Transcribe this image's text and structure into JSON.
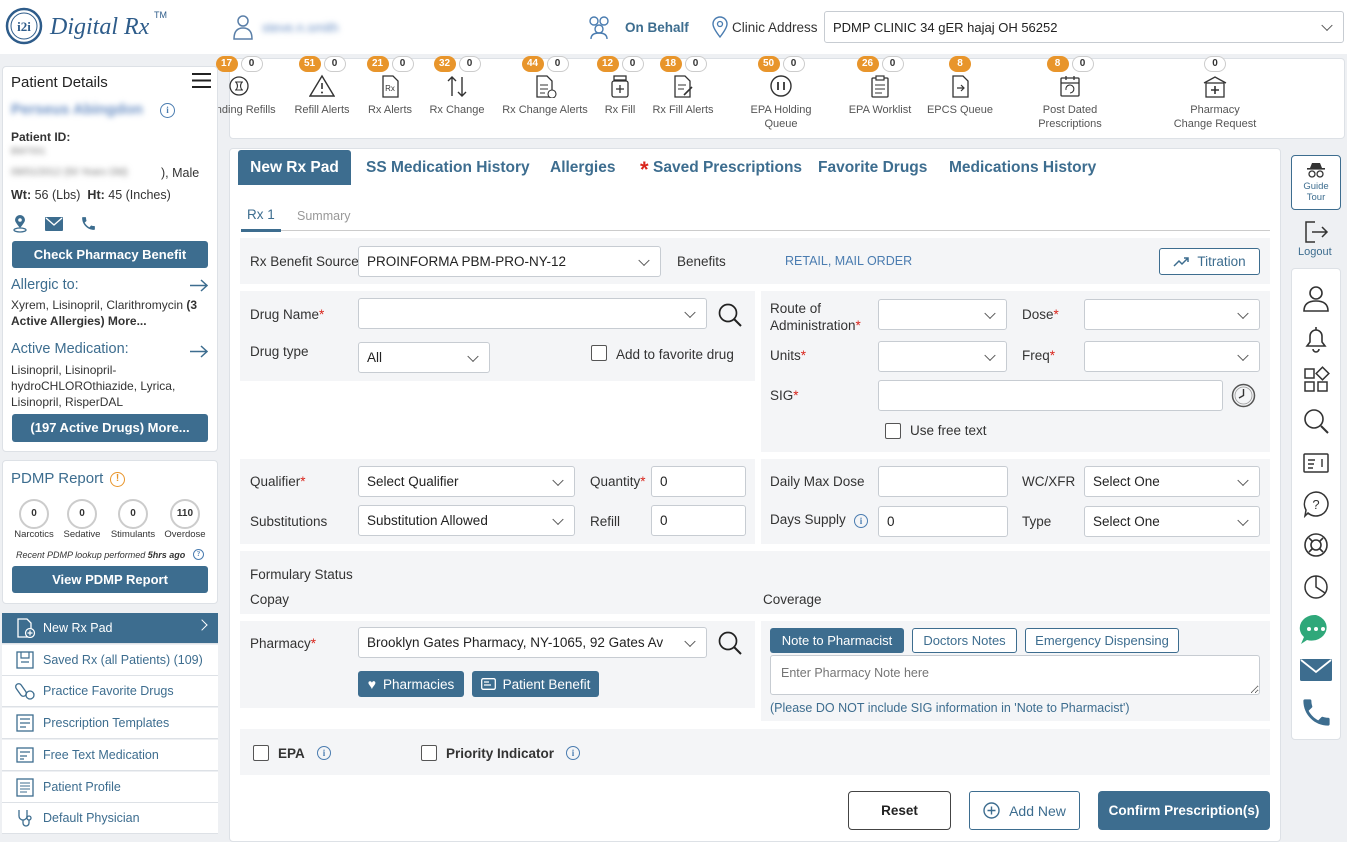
{
  "header": {
    "logo_text": "Digital Rx",
    "user_name": "steve.n.smith",
    "on_behalf": "On Behalf",
    "clinic_label": "Clinic Address",
    "clinic_value": "PDMP CLINIC 34 gER hajaj OH 56252"
  },
  "queues": [
    {
      "label": "Pending Refills",
      "count": "17",
      "extra": "0",
      "icon": "refill-pending-icon"
    },
    {
      "label": "Refill Alerts",
      "count": "51",
      "extra": "0",
      "icon": "warning-icon"
    },
    {
      "label": "Rx Alerts",
      "count": "21",
      "extra": "0",
      "icon": "rx-alert-icon"
    },
    {
      "label": "Rx Change",
      "count": "32",
      "extra": "0",
      "icon": "swap-arrows-icon"
    },
    {
      "label": "Rx Change Alerts",
      "count": "44",
      "extra": "0",
      "icon": "rx-change-alert-icon"
    },
    {
      "label": "Rx Fill",
      "count": "12",
      "extra": "0",
      "icon": "pill-bottle-icon"
    },
    {
      "label": "Rx Fill Alerts",
      "count": "18",
      "extra": "0",
      "icon": "rx-fill-alert-icon"
    },
    {
      "label": "EPA Holding Queue",
      "count": "50",
      "extra": "0",
      "icon": "pause-icon"
    },
    {
      "label": "EPA Worklist",
      "count": "26",
      "extra": "0",
      "icon": "clipboard-icon"
    },
    {
      "label": "EPCS Queue",
      "count": "8",
      "extra": "",
      "icon": "epcs-icon"
    },
    {
      "label": "Post Dated Prescriptions",
      "count": "8",
      "extra": "0",
      "icon": "calendar-refresh-icon"
    },
    {
      "label": "Pharmacy Change Request",
      "count": "",
      "extra": "0",
      "icon": "pharmacy-icon"
    }
  ],
  "patient": {
    "section_title": "Patient Details",
    "name": "Perseus Abingdon",
    "id_label": "Patient ID:",
    "id_value": "BW7001",
    "dob": "09/01/2012 (50 Years Old)",
    "gender": "), Male",
    "wt_label": "Wt:",
    "wt_value": "56 (Lbs)",
    "ht_label": "Ht:",
    "ht_value": "45 (Inches)",
    "check_benefit": "Check Pharmacy Benefit",
    "allergic_title": "Allergic to:",
    "allergies": "Xyrem, Lisinopril, Clarithromycin",
    "allergies_more": "(3 Active Allergies) More...",
    "meds_title": "Active Medication:",
    "meds": "Lisinopril, Lisinopril-hydroCHLOROthiazide, Lyrica, Lisinopril, RisperDAL",
    "meds_button": "(197 Active Drugs) More..."
  },
  "pdmp": {
    "title": "PDMP Report",
    "items": [
      {
        "label": "Narcotics",
        "value": "0"
      },
      {
        "label": "Sedative",
        "value": "0"
      },
      {
        "label": "Stimulants",
        "value": "0"
      },
      {
        "label": "Overdose",
        "value": "110"
      }
    ],
    "lookup_prefix": "Recent PDMP lookup performed",
    "lookup_time": "5hrs ago",
    "button": "View PDMP Report"
  },
  "menu": [
    {
      "label": "New Rx Pad",
      "icon": "new-rx-icon",
      "active": true
    },
    {
      "label": "Saved Rx (all Patients) (109)",
      "icon": "saved-rx-icon"
    },
    {
      "label": "Practice Favorite Drugs",
      "icon": "pills-icon"
    },
    {
      "label": "Prescription Templates",
      "icon": "template-icon"
    },
    {
      "label": "Free Text Medication",
      "icon": "free-text-icon"
    },
    {
      "label": "Patient Profile",
      "icon": "profile-icon"
    },
    {
      "label": "Default Physician",
      "icon": "stethoscope-icon"
    }
  ],
  "tabs": {
    "new_rx_pad": "New Rx Pad",
    "ss_history": "SS Medication History",
    "allergies": "Allergies",
    "saved_star": "*",
    "saved": "Saved Prescriptions",
    "favorite": "Favorite Drugs",
    "med_history": "Medications History"
  },
  "subtabs": {
    "rx1": "Rx 1",
    "summary": "Summary"
  },
  "form": {
    "benefit_source_label": "Rx Benefit Source",
    "benefit_source_value": "PROINFORMA PBM-PRO-NY-12",
    "benefits_label": "Benefits",
    "benefits_value": "RETAIL, MAIL ORDER",
    "titration": "Titration",
    "drug_name_label": "Drug Name",
    "drug_type_label": "Drug type",
    "drug_type_value": "All",
    "add_favorite": "Add to favorite drug",
    "route_label_1": "Route of",
    "route_label_2": "Administration",
    "dose_label": "Dose",
    "units_label": "Units",
    "freq_label": "Freq",
    "sig_label": "SIG",
    "free_text": "Use free text",
    "qualifier_label": "Qualifier",
    "qualifier_value": "Select Qualifier",
    "quantity_label": "Quantity",
    "quantity_value": "0",
    "substitutions_label": "Substitutions",
    "substitutions_value": "Substitution Allowed",
    "refill_label": "Refill",
    "refill_value": "0",
    "daily_max_label": "Daily Max Dose",
    "wc_label": "WC/XFR",
    "wc_value": "Select One",
    "days_supply_label": "Days Supply",
    "days_supply_value": "0",
    "type_label": "Type",
    "type_value": "Select One",
    "formulary_label": "Formulary Status",
    "copay_label": "Copay",
    "coverage_label": "Coverage",
    "pharmacy_label": "Pharmacy",
    "pharmacy_value": "Brooklyn Gates Pharmacy, NY-1065, 92 Gates Av",
    "pharmacies_btn": "Pharmacies",
    "patient_benefit_btn": "Patient Benefit",
    "note_tab": "Note to Pharmacist",
    "doctor_notes_tab": "Doctors Notes",
    "emergency_tab": "Emergency Dispensing",
    "note_placeholder": "Enter Pharmacy Note here",
    "note_warning": "(Please DO NOT include SIG information in 'Note to Pharmacist')",
    "epa_label": "EPA",
    "priority_label": "Priority Indicator",
    "required_mark": "*"
  },
  "actions": {
    "reset": "Reset",
    "add_new": "Add New",
    "confirm": "Confirm Prescription(s)"
  },
  "right_rail": {
    "guide_tour": "Guide Tour",
    "logout": "Logout"
  }
}
